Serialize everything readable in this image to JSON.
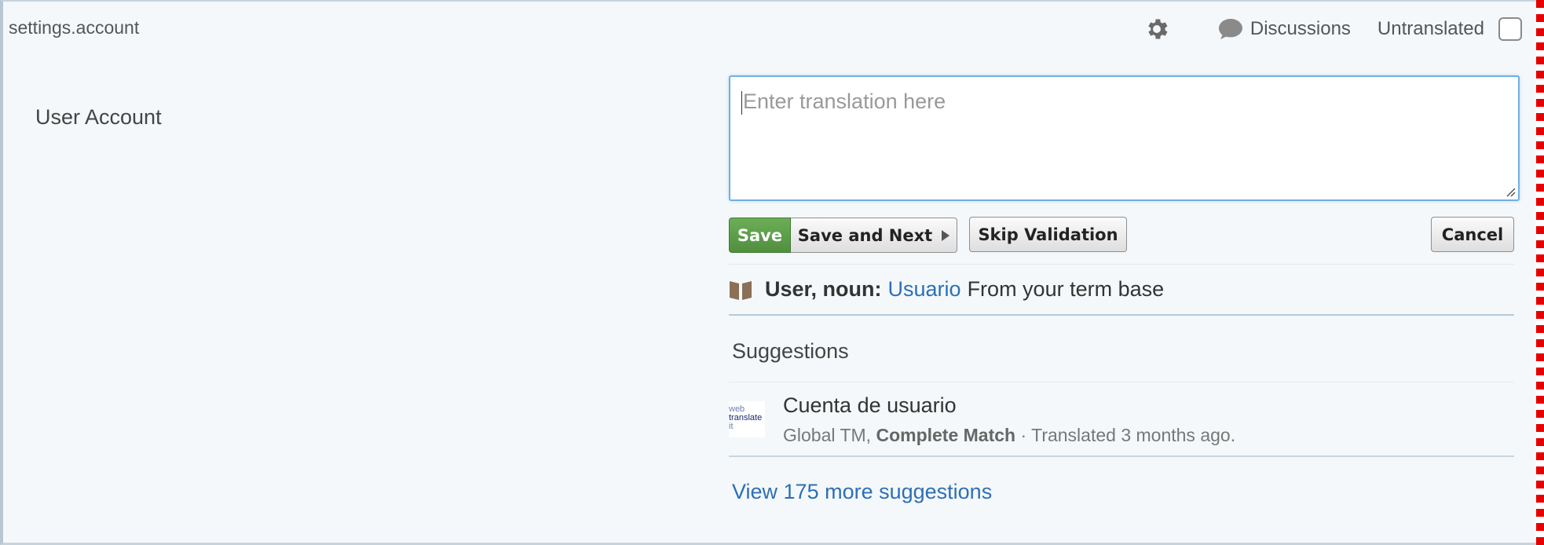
{
  "string_key": "settings.account",
  "toolbar": {
    "settings_icon": "gear-icon",
    "discussions_label": "Discussions",
    "untranslated_label": "Untranslated",
    "untranslated_checked": false
  },
  "source_text": "User Account",
  "editor": {
    "placeholder": "Enter translation here",
    "value": ""
  },
  "actions": {
    "save": "Save",
    "save_and_next": "Save and Next",
    "skip_validation": "Skip Validation",
    "cancel": "Cancel"
  },
  "term_base": {
    "term": "User, noun:",
    "translation": "Usuario",
    "source": "From your term base"
  },
  "suggestions": {
    "heading": "Suggestions",
    "items": [
      {
        "logo_text": [
          "web",
          "translate",
          "it"
        ],
        "text": "Cuenta de usuario",
        "origin": "Global TM,",
        "match": "Complete Match",
        "when": "· Translated 3 months ago."
      }
    ],
    "more_link": "View 175 more suggestions"
  },
  "colors": {
    "accent": "#2d6fb5",
    "save_green": "#5a9e47",
    "background": "#f4f8fa"
  }
}
